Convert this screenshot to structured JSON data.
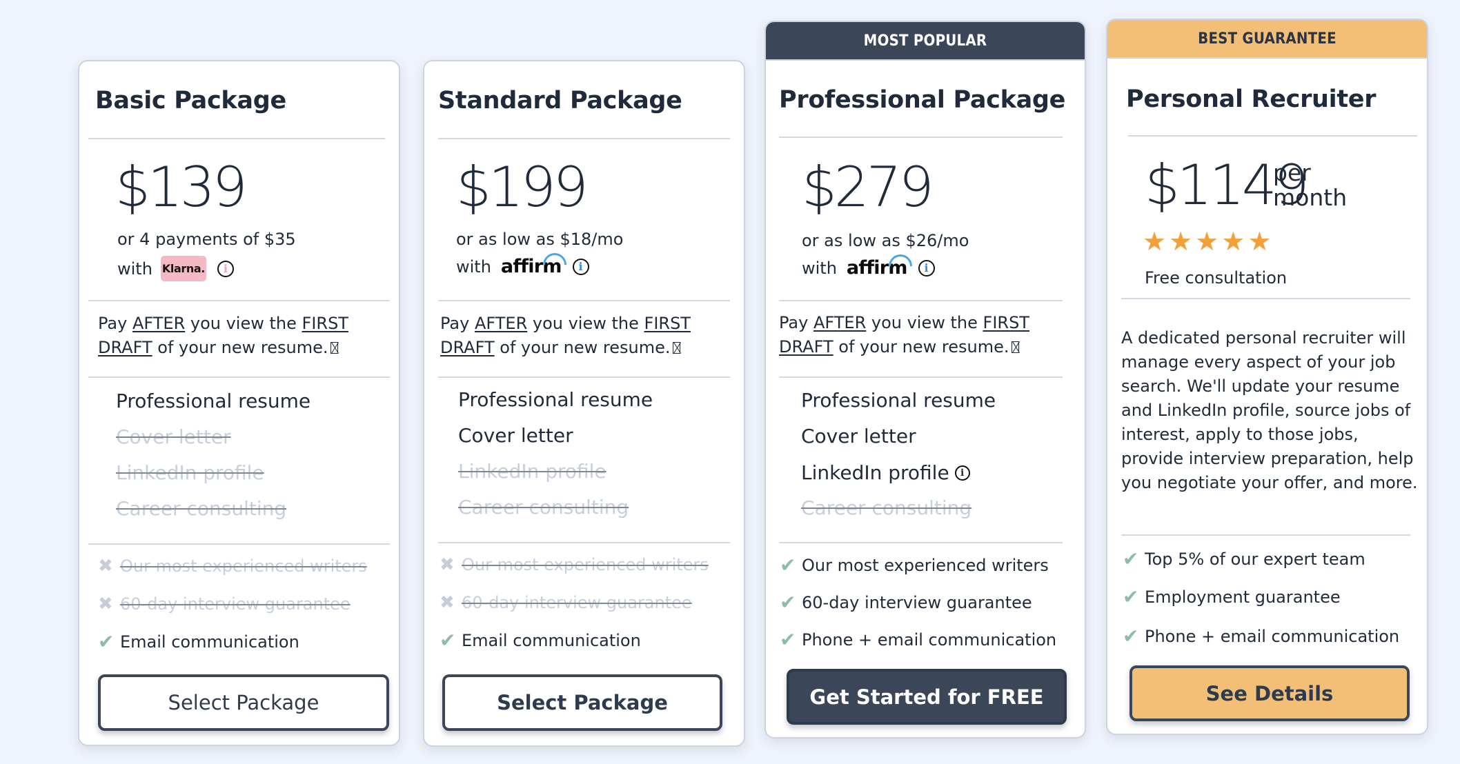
{
  "colors": {
    "background": "#eff3fb",
    "dark_accent": "#3b4759",
    "gold_accent": "#f3bf76",
    "check_green": "#8dbcaa",
    "star_orange": "#f4a03a",
    "klarna_pink": "#f5b8c5",
    "affirm_blue": "#4aa6e8"
  },
  "cards": [
    {
      "title": "Basic Package",
      "price": "$139",
      "payment_line1": "or 4 payments of $35",
      "payment_with": "with",
      "payment_provider": "Klarna.",
      "payment_provider_icon": "klarna-logo",
      "draft_note": {
        "pre": "Pay ",
        "after": "AFTER",
        "mid": " you view the ",
        "first_draft": "FIRST DRAFT",
        "post": " of your new resume."
      },
      "features": [
        {
          "label": "Professional resume",
          "included": true
        },
        {
          "label": "Cover letter",
          "included": false
        },
        {
          "label": "LinkedIn profile",
          "included": false
        },
        {
          "label": "Career consulting",
          "included": false
        }
      ],
      "bullets": [
        {
          "label": "Our most experienced writers",
          "included": false,
          "icon": "cross-icon"
        },
        {
          "label": "60-day interview guarantee",
          "included": false,
          "icon": "cross-icon"
        },
        {
          "label": "Email communication",
          "included": true,
          "icon": "check-icon"
        }
      ],
      "button": "Select Package"
    },
    {
      "title": "Standard Package",
      "price": "$199",
      "payment_line1": "or as low as $18/mo",
      "payment_with": "with",
      "payment_provider": "affirm",
      "payment_provider_icon": "affirm-logo",
      "draft_note": {
        "pre": "Pay ",
        "after": "AFTER",
        "mid": " you view the ",
        "first_draft": "FIRST DRAFT",
        "post": " of your new resume."
      },
      "features": [
        {
          "label": "Professional resume",
          "included": true
        },
        {
          "label": "Cover letter",
          "included": true
        },
        {
          "label": "LinkedIn profile",
          "included": false
        },
        {
          "label": "Career consulting",
          "included": false
        }
      ],
      "bullets": [
        {
          "label": "Our most experienced writers",
          "included": false,
          "icon": "cross-icon"
        },
        {
          "label": "60-day interview guarantee",
          "included": false,
          "icon": "cross-icon"
        },
        {
          "label": "Email communication",
          "included": true,
          "icon": "check-icon"
        }
      ],
      "button": "Select Package"
    },
    {
      "banner": "MOST POPULAR",
      "title": "Professional Package",
      "price": "$279",
      "payment_line1": "or as low as $26/mo",
      "payment_with": "with",
      "payment_provider": "affirm",
      "payment_provider_icon": "affirm-logo",
      "draft_note": {
        "pre": "Pay ",
        "after": "AFTER",
        "mid": " you view the ",
        "first_draft": "FIRST DRAFT",
        "post": " of your new resume."
      },
      "features": [
        {
          "label": "Professional resume",
          "included": true
        },
        {
          "label": "Cover letter",
          "included": true
        },
        {
          "label": "LinkedIn profile",
          "included": true,
          "info": true
        },
        {
          "label": "Career consulting",
          "included": false
        }
      ],
      "bullets": [
        {
          "label": "Our most experienced writers",
          "included": true,
          "icon": "check-icon"
        },
        {
          "label": "60-day interview guarantee",
          "included": true,
          "icon": "check-icon"
        },
        {
          "label": "Phone + email communication",
          "included": true,
          "icon": "check-icon"
        }
      ],
      "button": "Get Started for FREE"
    },
    {
      "banner": "BEST GUARANTEE",
      "title": "Personal Recruiter",
      "price": "$1149",
      "price_unit_line1": "per",
      "price_unit_line2": "month",
      "rating": {
        "value": 5,
        "max": 5
      },
      "rating_caption": "Free consultation",
      "description": "A dedicated personal recruiter will manage every aspect of your job search. We'll update your resume and LinkedIn profile, source jobs of interest, apply to those jobs, provide interview preparation, help you negotiate your offer, and more.",
      "bullets": [
        {
          "label": "Top 5% of our expert team",
          "included": true,
          "icon": "check-icon"
        },
        {
          "label": "Employment guarantee",
          "included": true,
          "icon": "check-icon"
        },
        {
          "label": "Phone + email communication",
          "included": true,
          "icon": "check-icon"
        }
      ],
      "button": "See Details"
    }
  ]
}
